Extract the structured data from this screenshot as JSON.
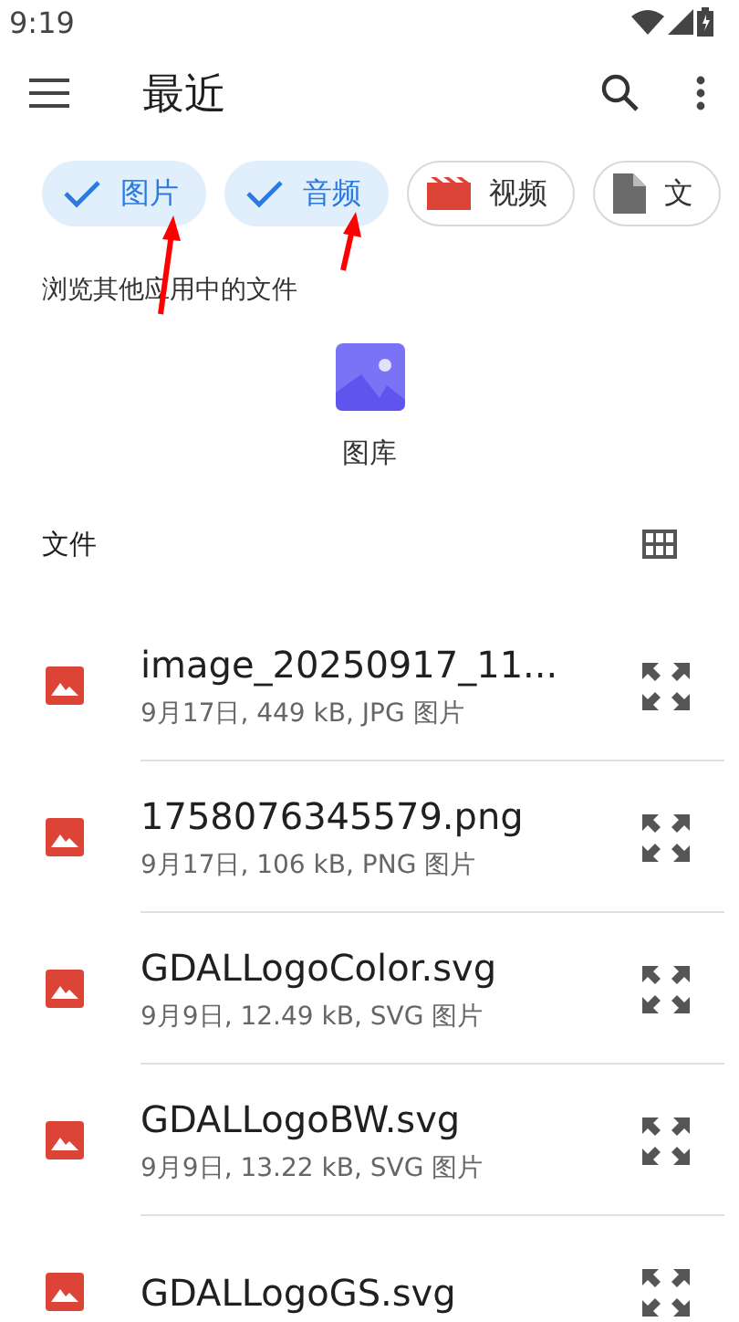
{
  "status_bar": {
    "time": "9:19"
  },
  "app_bar": {
    "title": "最近"
  },
  "chips": [
    {
      "label": "图片",
      "selected": true
    },
    {
      "label": "音频",
      "selected": true
    },
    {
      "label": "视频",
      "kind": "video",
      "selected": false
    },
    {
      "label": "文",
      "kind": "document",
      "selected": false
    }
  ],
  "other_apps": {
    "heading": "浏览其他应用中的文件",
    "apps": [
      {
        "label": "图库"
      }
    ]
  },
  "files": {
    "heading": "文件",
    "items": [
      {
        "name": "image_20250917_11...",
        "meta": "9月17日, 449 kB, JPG 图片"
      },
      {
        "name": "1758076345579.png",
        "meta": "9月17日, 106 kB, PNG 图片"
      },
      {
        "name": "GDALLogoColor.svg",
        "meta": "9月9日, 12.49 kB, SVG 图片"
      },
      {
        "name": "GDALLogoBW.svg",
        "meta": "9月9日, 13.22 kB, SVG 图片"
      },
      {
        "name": "GDALLogoGS.svg"
      }
    ]
  }
}
